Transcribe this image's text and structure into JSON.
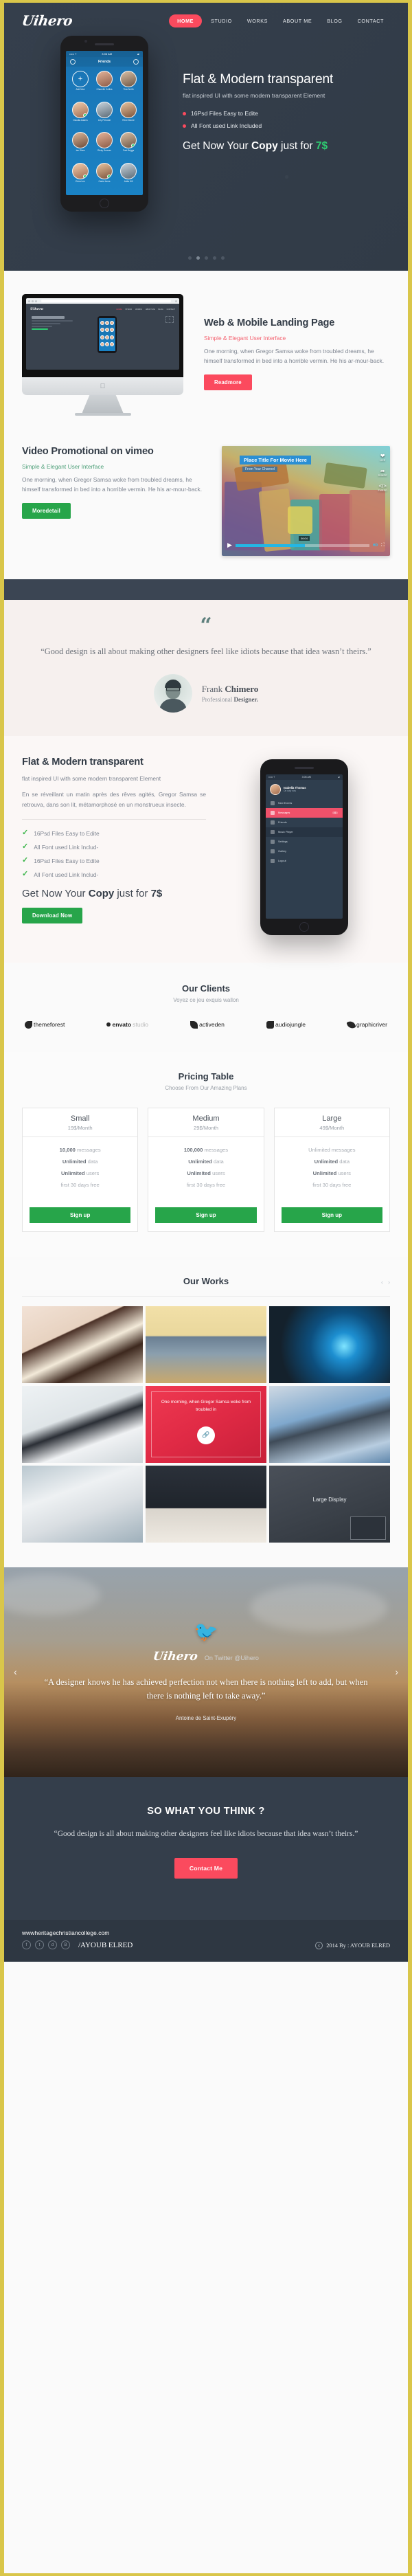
{
  "brand": {
    "logo": "Uihero",
    "accent_red": "#fb4a5e",
    "accent_green": "#27a54a",
    "dark": "#343e4b",
    "border_yellow": "#d9c64a"
  },
  "nav": {
    "items": [
      {
        "label": "HOME",
        "active": true
      },
      {
        "label": "STUDIO",
        "active": false
      },
      {
        "label": "WORKS",
        "active": false
      },
      {
        "label": "ABOUT ME",
        "active": false
      },
      {
        "label": "BLOG",
        "active": false
      },
      {
        "label": "CONTACT",
        "active": false
      }
    ]
  },
  "hero": {
    "title": "Flat & Modern transparent",
    "subtitle": "flat inspired UI with some modern transparent Element",
    "features": [
      "16Psd Files Easy to Edite",
      "All Font used Link Included"
    ],
    "cta_prefix": "Get Now Your ",
    "cta_bold": "Copy",
    "cta_mid": " just for ",
    "cta_price": "7$",
    "phone": {
      "status_left": "••••• ?",
      "status_time": "3:06 AM",
      "screen_title": "Friends",
      "contacts": [
        {
          "name": "Add New",
          "add": true
        },
        {
          "name": "Chanelle Collins"
        },
        {
          "name": "Tina Smith"
        },
        {
          "name": "Claudia Adams"
        },
        {
          "name": "Lilly Petroski"
        },
        {
          "name": "Rene Moore"
        },
        {
          "name": "Ian Shea"
        },
        {
          "name": "Ricky Duncan"
        },
        {
          "name": "Fred Briggs"
        },
        {
          "name": "Edna Lee"
        },
        {
          "name": "Carla Jones"
        },
        {
          "name": "Anita Hill"
        }
      ]
    },
    "slider_dots": 5,
    "active_dot": 2
  },
  "web_mobile": {
    "title": "Web & Mobile Landing Page",
    "kicker": "Simple & Elegant User Interface",
    "body": "One morning, when Gregor Samsa woke from troubled dreams, he himself transformed in bed into a horrible vermin. He  his ar-mour-back.",
    "button": "Readmore"
  },
  "video": {
    "title": "Video Promotional on vimeo",
    "kicker": "Simple & Elegant User Interface",
    "body": "One morning, when Gregor Samsa woke from troubled dreams, he himself transformed in bed into a horrible vermin. He  his ar-mour-back.",
    "button": "Moredetail",
    "thumb_title": "Place Title For Movie Here",
    "thumb_sub": "From Your Channel",
    "side_actions": [
      "LIKE",
      "SHARE",
      "EMBED"
    ],
    "timestamp": "06:04",
    "quality": "HD"
  },
  "testimonial": {
    "quote_mark": "“",
    "quote": "“Good design is all about making other designers feel like idiots because that idea wasn’t theirs.”",
    "name_first": "Frank ",
    "name_last": "Chimero",
    "role_pre": "Professional ",
    "role_bold": "Designer."
  },
  "features": {
    "title": "Flat & Modern transparent",
    "subtitle": "flat inspired UI with some modern transparent Element",
    "body": "En se réveillant un matin après des rêves agités, Gregor Samsa se retrouva, dans son lit, métamorphosé en un monstrueux insecte.",
    "checks": [
      "16Psd Files Easy to Edite",
      "All Font used Link Includ-",
      "16Psd Files Easy to Edite",
      "All Font used Link Includ-"
    ],
    "cta_prefix": "Get Now Your ",
    "cta_bold": "Copy",
    "cta_mid": " just for ",
    "cta_price": "7$",
    "button": "Download Now",
    "phone": {
      "status_left": "••••• ?",
      "status_time": "3:06 AM",
      "profile_name": "Isabella Thomas",
      "profile_sub": "On duty now",
      "menu": [
        {
          "label": "New Events",
          "style": "plain",
          "badge": ""
        },
        {
          "label": "Messages",
          "style": "hot",
          "badge": "6"
        },
        {
          "label": "Friends",
          "style": "plain",
          "badge": ""
        },
        {
          "label": "Music Player",
          "style": "dark",
          "badge": ""
        },
        {
          "label": "Settings",
          "style": "plain",
          "badge": ""
        },
        {
          "label": "Gallery",
          "style": "plain",
          "badge": ""
        },
        {
          "label": "Logout",
          "style": "plain",
          "badge": ""
        }
      ]
    }
  },
  "clients": {
    "title": "Our Clients",
    "subtitle": "Voyez ce jeu exquis wallon",
    "logos": [
      {
        "name": "themeforest",
        "grey_part": ""
      },
      {
        "name": "envato",
        "grey_part": "studio"
      },
      {
        "name": "activeden",
        "grey_part": ""
      },
      {
        "name": "audiojungle",
        "grey_part": ""
      },
      {
        "name": "graphicriver",
        "grey_part": ""
      }
    ]
  },
  "pricing": {
    "title": "Pricing Table",
    "subtitle": "Choose From Our Amazing Plans",
    "plans": [
      {
        "name": "Small",
        "price": "19$/Month",
        "features": [
          {
            "pre": "",
            "bold": "10,000",
            "post": " messages"
          },
          {
            "pre": "",
            "bold": "Unlimited",
            "post": " data"
          },
          {
            "pre": "",
            "bold": "Unlimited",
            "post": " users"
          },
          {
            "pre": "",
            "bold": "",
            "post": "first 30 days free"
          }
        ],
        "button": "Sign up"
      },
      {
        "name": "Medium",
        "price": "29$/Month",
        "features": [
          {
            "pre": "",
            "bold": "100,000",
            "post": " messages"
          },
          {
            "pre": "",
            "bold": "Unlimited",
            "post": " data"
          },
          {
            "pre": "",
            "bold": "Unlimited",
            "post": " users"
          },
          {
            "pre": "",
            "bold": "",
            "post": "first 30 days free"
          }
        ],
        "button": "Sign up"
      },
      {
        "name": "Large",
        "price": "49$/Month",
        "features": [
          {
            "pre": "",
            "bold": "",
            "post": "Unlimited messages"
          },
          {
            "pre": "",
            "bold": "Unlimited",
            "post": " data"
          },
          {
            "pre": "",
            "bold": "Unlimited",
            "post": " users"
          },
          {
            "pre": "",
            "bold": "",
            "post": "first 30 days free"
          }
        ],
        "button": "Sign up"
      }
    ]
  },
  "works": {
    "title": "Our Works",
    "prev": "‹",
    "next": "›",
    "tiles": [
      {
        "kind": "photo",
        "label": "ice-cream-sandwiches"
      },
      {
        "kind": "photo",
        "label": "manhattan-bridge"
      },
      {
        "kind": "photo",
        "label": "camera-lens"
      },
      {
        "kind": "photo",
        "label": "man-with-laptop"
      },
      {
        "kind": "overlay",
        "label": "red-overlay",
        "text": "One morning, when Gregor Samsa woke from troubled in",
        "text_bold": "One morning, when Gregor",
        "icon": "link-icon"
      },
      {
        "kind": "photo",
        "label": "man-with-glasses"
      },
      {
        "kind": "photo",
        "label": "laptop-browser"
      },
      {
        "kind": "photo",
        "label": "imac-desk"
      },
      {
        "kind": "label",
        "label": "large-display",
        "text": "Large Display"
      }
    ]
  },
  "twitter": {
    "icon": "twitter-bird-icon",
    "logo": "Uihero",
    "handle_pre": "On Twitter ",
    "handle": "@Uihero",
    "quote": "“A designer knows he has achieved perfection not when there is nothing left to add, but when there is nothing left to take away.”",
    "author": "Antoine de Saint-Exupéry",
    "prev": "‹",
    "next": "›"
  },
  "contact": {
    "title": "SO WHAT YOU THINK ?",
    "quote": "“Good design is all about making other designers feel like idiots because that idea wasn’t theirs.”",
    "button": "Contact Me"
  },
  "footer": {
    "site": "wwwheritagechristiancollege.com",
    "socials": [
      "facebook-icon",
      "twitter-icon",
      "dribbble-icon",
      "behance-icon"
    ],
    "handle": "/AYOUB ELRED",
    "copyright": "2014  By : AYOUB ELRED"
  }
}
